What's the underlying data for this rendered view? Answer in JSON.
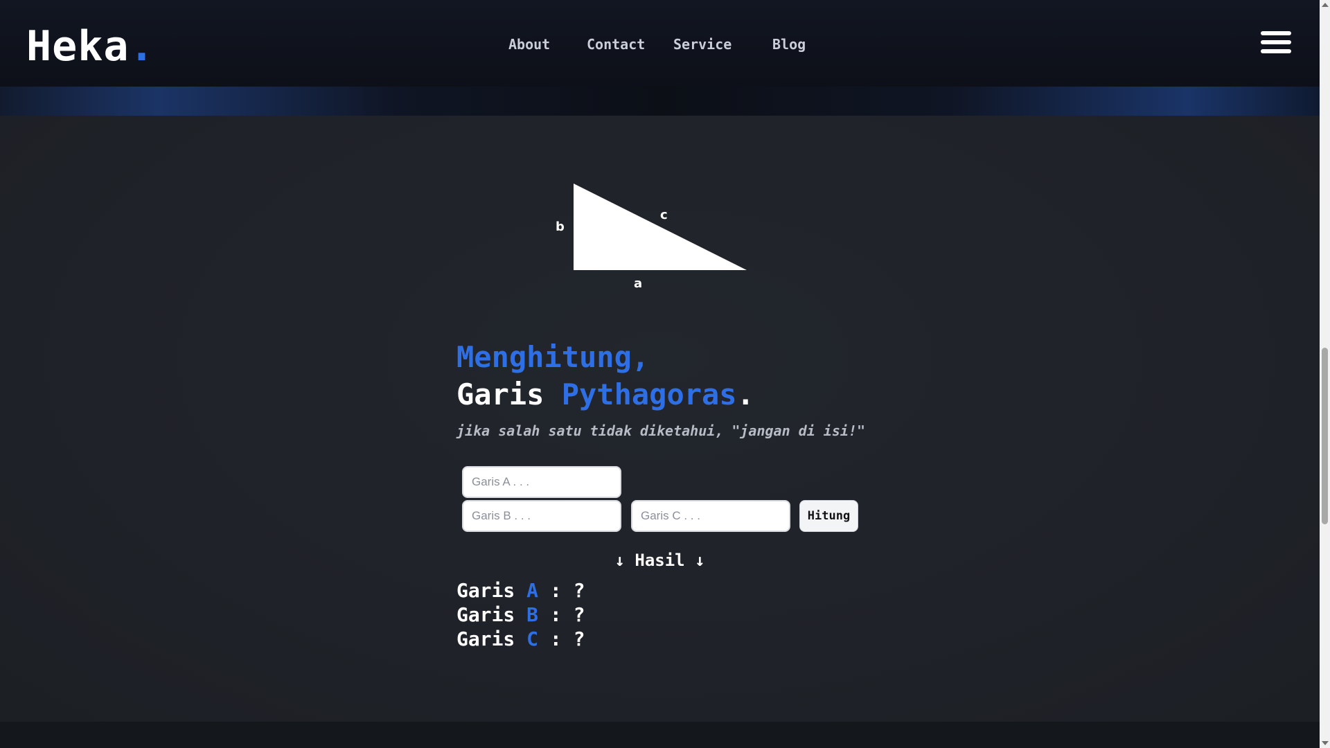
{
  "header": {
    "logo_text": "Heka",
    "logo_dot": ".",
    "nav": [
      {
        "label": "About"
      },
      {
        "label": "Contact"
      },
      {
        "label": "Service"
      },
      {
        "label": "Blog"
      }
    ],
    "menu_icon": "hamburger-menu-icon"
  },
  "diagram": {
    "label_a": "a",
    "label_b": "b",
    "label_c": "c"
  },
  "title": {
    "line1": "Menghitung,",
    "line2_white": "Garis",
    "line2_blue": "Pythagoras",
    "line2_dot": "."
  },
  "hint": "jika salah satu tidak diketahui, \"jangan di isi!\"",
  "form": {
    "a_placeholder": "Garis A . . .",
    "b_placeholder": "Garis B . . .",
    "c_placeholder": "Garis C . . .",
    "a_value": "",
    "b_value": "",
    "c_value": "",
    "button_label": "Hitung"
  },
  "results": {
    "heading": "↓ Hasil ↓",
    "rows": [
      {
        "prefix": "Garis ",
        "letter": "A",
        "suffix": " : ?"
      },
      {
        "prefix": "Garis ",
        "letter": "B",
        "suffix": " : ?"
      },
      {
        "prefix": "Garis ",
        "letter": "C",
        "suffix": " : ?"
      }
    ]
  },
  "colors": {
    "accent": "#2f6fe6",
    "background": "#1f2228",
    "header": "#0d1018"
  }
}
